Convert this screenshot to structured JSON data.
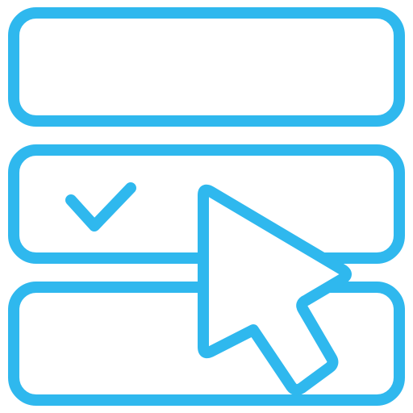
{
  "icon": {
    "name": "select-list-item-icon",
    "stroke_color": "#2FB8EE",
    "fill_color": "#FFFFFF",
    "rows": [
      {
        "name": "list-row-top",
        "checked": false
      },
      {
        "name": "list-row-middle",
        "checked": true
      },
      {
        "name": "list-row-bottom",
        "checked": false
      }
    ],
    "elements": {
      "checkmark": "check-icon",
      "cursor": "pointer-cursor-icon"
    }
  }
}
